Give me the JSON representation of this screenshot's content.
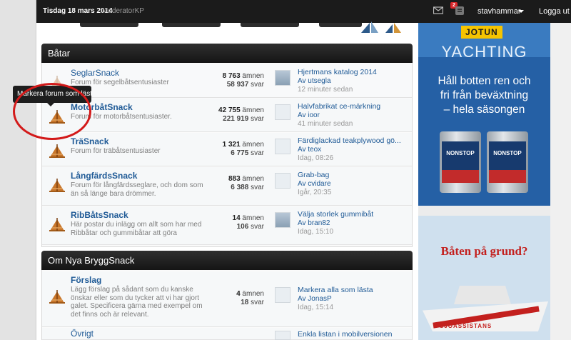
{
  "topbar": {
    "date": "Tisdag 18 mars 2014",
    "role": "ModeratorKP",
    "notification_count": "2",
    "username": "stavhammar",
    "logout": "Logga ut"
  },
  "tooltip": "Markera forum som läst",
  "sections": [
    {
      "title": "Båtar",
      "forums": [
        {
          "name": "SeglarSnack",
          "desc": "Forum för segelbåtsentusiaster",
          "threads": "8 763",
          "threads_label": "ämnen",
          "replies": "58 937",
          "replies_label": "svar",
          "last_title": "Hjertmans katalog 2014",
          "last_by": "Av utsegla",
          "last_time": "12 minuter sedan",
          "read": true
        },
        {
          "name": "MotorbåtSnack",
          "desc": "Forum för motorbåtsentusiaster.",
          "threads": "42 755",
          "threads_label": "ämnen",
          "replies": "221 919",
          "replies_label": "svar",
          "last_title": "Halvfabrikat ce-märkning",
          "last_by": "Av ioor",
          "last_time": "41 minuter sedan",
          "read": false
        },
        {
          "name": "TräSnack",
          "desc": "Forum för träbåtsentusiaster",
          "threads": "1 321",
          "threads_label": "ämnen",
          "replies": "6 775",
          "replies_label": "svar",
          "last_title": "Färdiglackad teakplywood gö...",
          "last_by": "Av teox",
          "last_time": "Idag, 08:26",
          "read": false
        },
        {
          "name": "LångfärdsSnack",
          "desc": "Forum för långfärdsseglare, och dom som än så länge bara drömmer.",
          "threads": "883",
          "threads_label": "ämnen",
          "replies": "6 388",
          "replies_label": "svar",
          "last_title": "Grab-bag",
          "last_by": "Av cvidare",
          "last_time": "Igår, 20:35",
          "read": false
        },
        {
          "name": "RibBåtsSnack",
          "desc": "Här postar du inlägg om allt som har med Ribbåtar och gummibåtar att göra",
          "threads": "14",
          "threads_label": "ämnen",
          "replies": "106",
          "replies_label": "svar",
          "last_title": "Välja storlek gummibåt",
          "last_by": "Av bran82",
          "last_time": "Idag, 15:10",
          "read": false
        }
      ]
    },
    {
      "title": "Om Nya BryggSnack",
      "forums": [
        {
          "name": "Förslag",
          "desc": "Lägg förslag på sådant som du kanske önskar eller som du tycker att vi har gjort galet. Specificera gärna med exempel om det finns och är relevant.",
          "threads": "4",
          "threads_label": "ämnen",
          "replies": "18",
          "replies_label": "svar",
          "last_title": "Markera alla som lästa",
          "last_by": "Av JonasP",
          "last_time": "Idag, 15:14",
          "read": false
        },
        {
          "name": "Övrigt",
          "desc": "",
          "threads": "",
          "threads_label": "",
          "replies": "",
          "replies_label": "",
          "last_title": "Enkla listan i mobilversionen",
          "last_by": "",
          "last_time": "",
          "read": false
        }
      ]
    }
  ],
  "ads": {
    "jotun": {
      "brand": "JOTUN",
      "headline": "YACHTING",
      "line1": "Håll botten ren och",
      "line2": "fri från beväxtning",
      "line3": "– hela säsongen",
      "can_label": "NONSTOP"
    },
    "boat": {
      "headline": "Båten på grund?",
      "boat_name": "SJÖASSISTANS"
    }
  },
  "colors": {
    "link": "#1f5a96",
    "header_bg": "#1b1b1b",
    "ad_blue": "#2560a5",
    "annotation_red": "#d31a1a"
  }
}
